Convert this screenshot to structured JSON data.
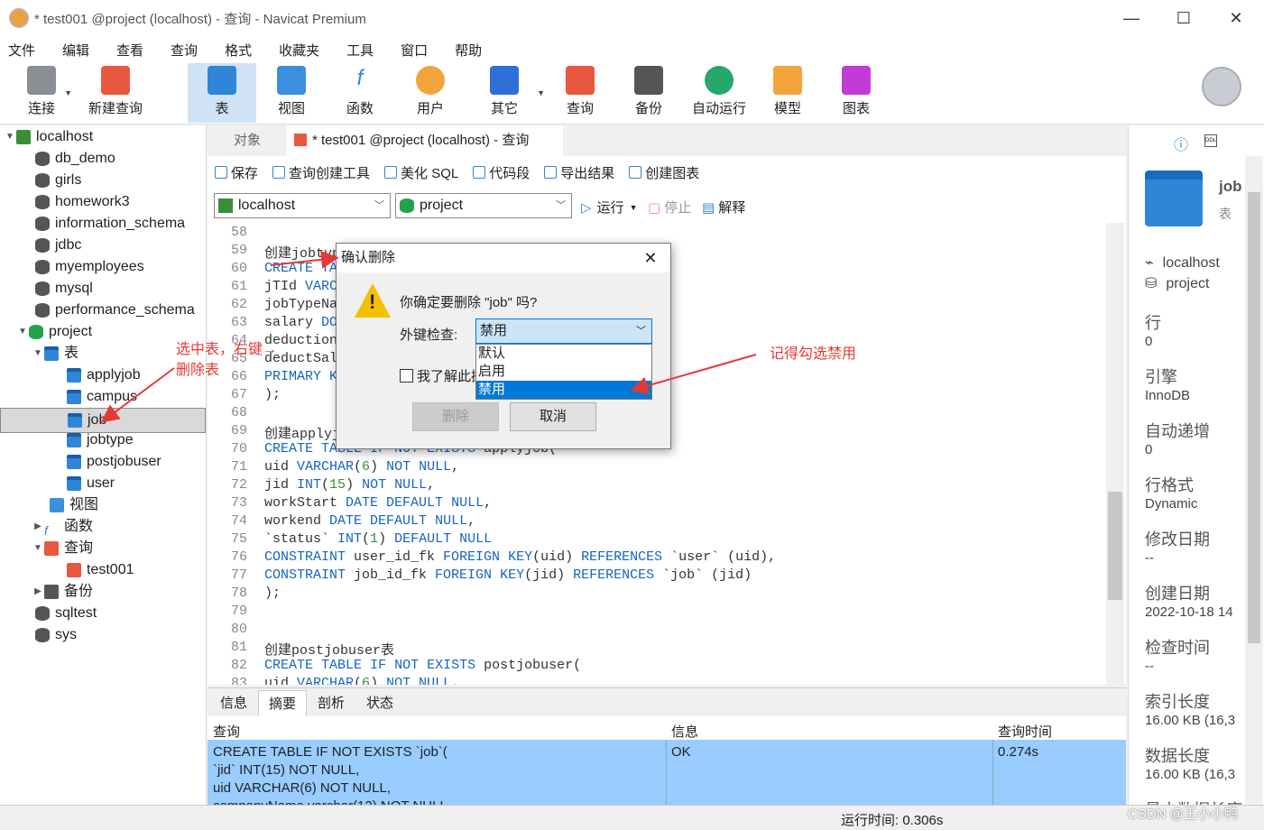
{
  "window": {
    "title": "* test001 @project (localhost) - 查询 - Navicat Premium",
    "min": "—",
    "max": "☐",
    "close": "✕"
  },
  "menu": [
    "文件",
    "编辑",
    "查看",
    "查询",
    "格式",
    "收藏夹",
    "工具",
    "窗口",
    "帮助"
  ],
  "toolbar": {
    "connect": "连接",
    "new_query": "新建查询",
    "table": "表",
    "view": "视图",
    "function": "函数",
    "user": "用户",
    "other": "其它",
    "query": "查询",
    "backup": "备份",
    "autorun": "自动运行",
    "model": "模型",
    "chart": "图表"
  },
  "tree": {
    "localhost": "localhost",
    "dbs": [
      "db_demo",
      "girls",
      "homework3",
      "information_schema",
      "jdbc",
      "myemployees",
      "mysql",
      "performance_schema"
    ],
    "project": "project",
    "tables_label": "表",
    "tables": [
      "applyjob",
      "campus",
      "job",
      "jobtype",
      "postjobuser",
      "user"
    ],
    "views": "视图",
    "functions": "函数",
    "queries": "查询",
    "query_item": "test001",
    "backups": "备份",
    "more_dbs": [
      "sqltest",
      "sys"
    ]
  },
  "tabs": {
    "objects": "对象",
    "query_tab": "* test001 @project (localhost) - 查询"
  },
  "query_toolbar": {
    "save": "保存",
    "builder": "查询创建工具",
    "beautify": "美化 SQL",
    "snippet": "代码段",
    "export": "导出结果",
    "create_chart": "创建图表"
  },
  "selectors": {
    "connection": "localhost",
    "database": "project",
    "run": "运行",
    "stop": "停止",
    "explain": "解释"
  },
  "editor": {
    "lines": [
      {
        "n": "58",
        "t": ""
      },
      {
        "n": "59",
        "t": "创建jobtype表"
      },
      {
        "n": "60",
        "t": "CREATE TABLE IF NOT EXISTS jobtype("
      },
      {
        "n": "61",
        "t": "jTId VARCHAR(6) NOT NULL,"
      },
      {
        "n": "62",
        "t": "jobTypeName VARCHAR(20) NOT NULL,"
      },
      {
        "n": "63",
        "t": "salary DOUBLE NOT NULL,"
      },
      {
        "n": "64",
        "t": "deduction DOUBLE NOT NULL,"
      },
      {
        "n": "65",
        "t": "deductSalary DOUBLE NOT NULL,"
      },
      {
        "n": "66",
        "t": "PRIMARY KEY(jTId)"
      },
      {
        "n": "67",
        "t": ");"
      },
      {
        "n": "68",
        "t": ""
      },
      {
        "n": "69",
        "t": "创建applyjob表"
      },
      {
        "n": "70",
        "t": "CREATE TABLE IF NOT EXISTS applyjob("
      },
      {
        "n": "71",
        "t": "uid VARCHAR(6) NOT NULL,"
      },
      {
        "n": "72",
        "t": "jid INT(15) NOT NULL,"
      },
      {
        "n": "73",
        "t": "workStart DATE DEFAULT NULL,"
      },
      {
        "n": "74",
        "t": "workend DATE DEFAULT NULL,"
      },
      {
        "n": "75",
        "t": "`status` INT(1) DEFAULT NULL"
      },
      {
        "n": "76",
        "t": "CONSTRAINT user_id_fk FOREIGN KEY(uid) REFERENCES `user` (uid),"
      },
      {
        "n": "77",
        "t": "CONSTRAINT job_id_fk FOREIGN KEY(jid) REFERENCES `job` (jid)"
      },
      {
        "n": "78",
        "t": ");"
      },
      {
        "n": "79",
        "t": ""
      },
      {
        "n": "80",
        "t": ""
      },
      {
        "n": "81",
        "t": "创建postjobuser表"
      },
      {
        "n": "82",
        "t": "CREATE TABLE IF NOT EXISTS postjobuser("
      },
      {
        "n": "83",
        "t": "uid VARCHAR(6) NOT NULL,"
      }
    ]
  },
  "bottom_tabs": [
    "信息",
    "摘要",
    "剖析",
    "状态"
  ],
  "results": {
    "headers": [
      "查询",
      "信息",
      "查询时间"
    ],
    "query": "CREATE TABLE IF NOT EXISTS `job`(\n`jid` INT(15) NOT NULL,\nuid VARCHAR(6) NOT NULL,\ncompanyName varchar(12) NOT NULL,",
    "info": "OK",
    "time": "0.274s"
  },
  "status": {
    "runtime": "运行时间: 0.306s"
  },
  "right_panel": {
    "name": "job",
    "type": "表",
    "conn": "localhost",
    "db": "project",
    "props": [
      {
        "label": "行",
        "value": "0"
      },
      {
        "label": "引擎",
        "value": "InnoDB"
      },
      {
        "label": "自动递增",
        "value": "0"
      },
      {
        "label": "行格式",
        "value": "Dynamic"
      },
      {
        "label": "修改日期",
        "value": "--"
      },
      {
        "label": "创建日期",
        "value": "2022-10-18 14"
      },
      {
        "label": "检查时间",
        "value": "--"
      },
      {
        "label": "索引长度",
        "value": "16.00 KB (16,3"
      },
      {
        "label": "数据长度",
        "value": "16.00 KB (16,3"
      },
      {
        "label": "最大数据长度",
        "value": ""
      }
    ]
  },
  "dialog": {
    "title": "确认删除",
    "message": "你确定要删除 \"job\" 吗?",
    "fk_label": "外键检查:",
    "fk_value": "禁用",
    "options": [
      "默认",
      "启用",
      "禁用"
    ],
    "checkbox": "我了解此操",
    "delete": "删除",
    "cancel": "取消",
    "close": "✕"
  },
  "annotations": {
    "select_table": "选中表，右键→",
    "delete_table": "删除表",
    "remember": "记得勾选禁用"
  },
  "watermark": "CSDN @王小小鸭"
}
